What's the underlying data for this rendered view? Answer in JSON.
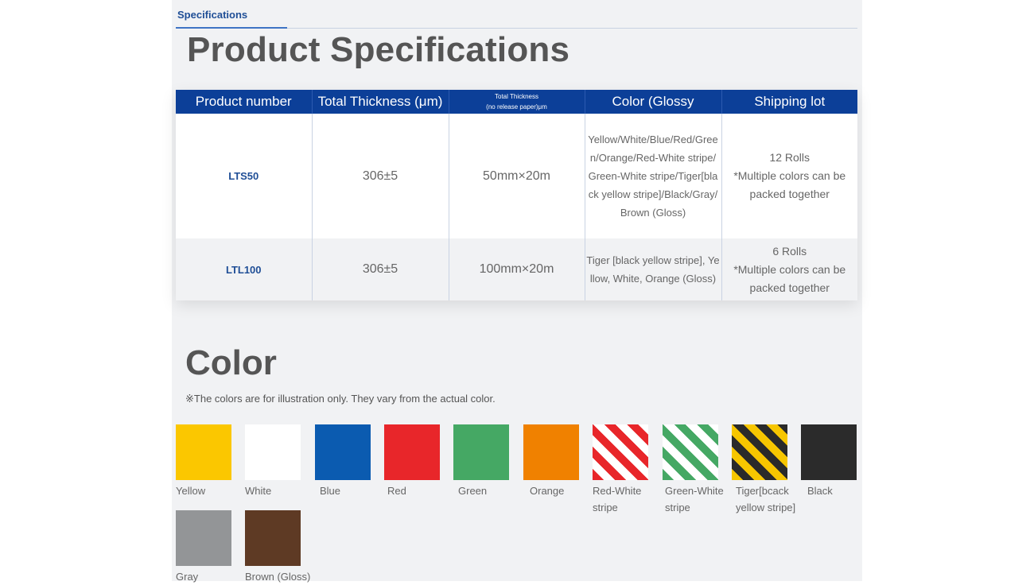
{
  "tab": {
    "label": "Specifications"
  },
  "title": "Product Specifications",
  "table": {
    "headers": [
      "Product number",
      "Total Thickness (μm)",
      "Total Thickness\n(no release paper)μm",
      "Color (Glossy",
      "Shipping lot"
    ],
    "header_small_1": "Total Thickness",
    "header_small_2": "(no release paper)μm",
    "rows": [
      {
        "product": "LTS50",
        "thickness": "306±5",
        "size": "50mm×20m",
        "color": "Yellow/White/Blue/Red/Green/Orange/Red-White stripe/ Green-White stripe/Tiger[black yellow stripe]/Black/Gray/Brown (Gloss)",
        "lot_1": "12 Rolls",
        "lot_2": "*Multiple colors can be packed together"
      },
      {
        "product": "LTL100",
        "thickness": "306±5",
        "size": "100mm×20m",
        "color": "Tiger [black yellow stripe], Yellow, White, Orange (Gloss)",
        "lot_1": "6 Rolls",
        "lot_2": "*Multiple colors can be packed together"
      }
    ]
  },
  "color_section": {
    "title": "Color",
    "note": "※The colors are for illustration only. They vary from the actual color.",
    "swatches": [
      {
        "label": "Yellow",
        "color": "#fbc700"
      },
      {
        "label": "White",
        "color": "#ffffff"
      },
      {
        "label": "Blue",
        "color": "#0b5bb0"
      },
      {
        "label": "Red",
        "color": "#e8262a"
      },
      {
        "label": "Green",
        "color": "#45a864"
      },
      {
        "label": "Orange",
        "color": "#f08100"
      },
      {
        "label": "Red-White stripe",
        "line1": "Red-White",
        "line2": "stripe",
        "pattern": "red-white-stripe"
      },
      {
        "label": "Green-White stripe",
        "line1": "Green-White",
        "line2": "stripe",
        "pattern": "green-white-stripe"
      },
      {
        "label": "Tiger[bcack yellow stripe]",
        "line1": "Tiger[bcack",
        "line2": "yellow stripe]",
        "pattern": "tiger-stripe"
      },
      {
        "label": "Black",
        "color": "#2b2b2b"
      },
      {
        "label": "Gray",
        "color": "#939597"
      },
      {
        "label": "Brown (Gloss)",
        "color": "#5e3a24"
      }
    ]
  }
}
